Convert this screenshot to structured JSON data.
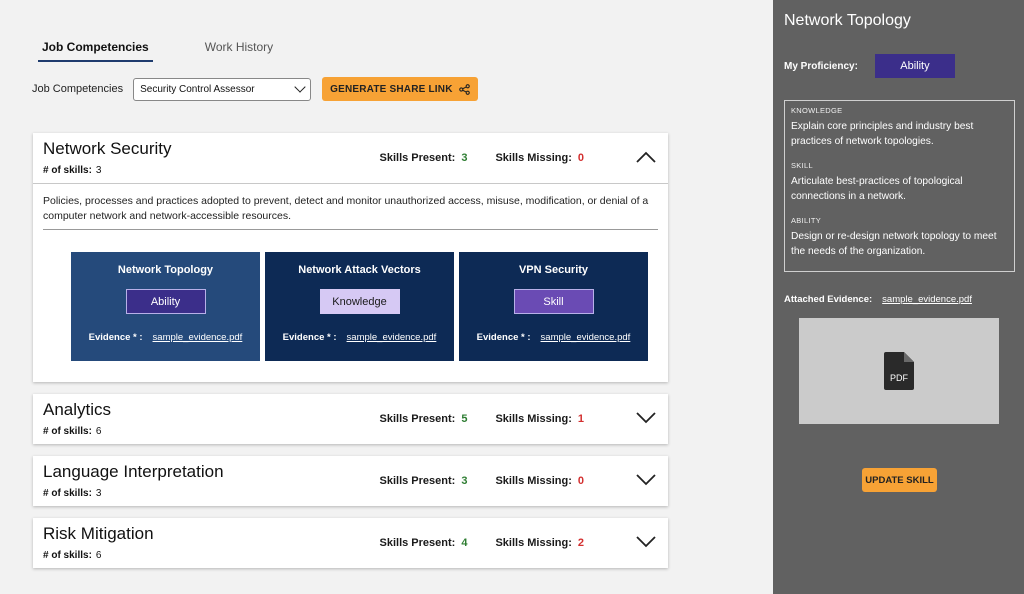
{
  "tabs": [
    {
      "label": "Job Competencies",
      "active": true
    },
    {
      "label": "Work History",
      "active": false
    }
  ],
  "filter": {
    "label": "Job Competencies",
    "selected": "Security Control Assessor",
    "share_button": "GENERATE SHARE LINK"
  },
  "labels": {
    "num_skills": "# of skills:",
    "skills_present": "Skills Present:",
    "skills_missing": "Skills Missing:",
    "evidence": "Evidence * :"
  },
  "competencies": [
    {
      "title": "Network Security",
      "num_skills": "3",
      "present": "3",
      "missing": "0",
      "expanded": true,
      "description": "Policies, processes and practices adopted to prevent, detect and monitor unauthorized access, misuse, modification, or denial of a computer network and network-accessible resources.",
      "skills": [
        {
          "title": "Network Topology",
          "tag": "Ability",
          "evidence": "sample_evidence.pdf",
          "bg": "#254a7b",
          "tag_bg": "#3b2e8a",
          "tag_color": "#ffffff"
        },
        {
          "title": "Network Attack Vectors",
          "tag": "Knowledge",
          "evidence": "sample_evidence.pdf",
          "bg": "#0d2a55",
          "tag_bg": "#d6c9f4",
          "tag_color": "#1a1a1a"
        },
        {
          "title": "VPN Security",
          "tag": "Skill",
          "evidence": "sample_evidence.pdf",
          "bg": "#0d2a55",
          "tag_bg": "#6a4bb4",
          "tag_color": "#ffffff"
        }
      ]
    },
    {
      "title": "Analytics",
      "num_skills": "6",
      "present": "5",
      "missing": "1",
      "expanded": false
    },
    {
      "title": "Language Interpretation",
      "num_skills": "3",
      "present": "3",
      "missing": "0",
      "expanded": false
    },
    {
      "title": "Risk Mitigation",
      "num_skills": "6",
      "present": "4",
      "missing": "2",
      "expanded": false
    }
  ],
  "panel": {
    "title": "Network Topology",
    "proficiency_label": "My Proficiency:",
    "proficiency": "Ability",
    "sections": [
      {
        "label": "KNOWLEDGE",
        "text": "Explain core principles and industry best practices of network topologies."
      },
      {
        "label": "SKILL",
        "text": "Articulate best-practices of topological connections in a network."
      },
      {
        "label": "ABILITY",
        "text": "Design or re-design network topology to meet the needs of the organization."
      }
    ],
    "evidence_label": "Attached Evidence:",
    "evidence_file": "sample_evidence.pdf",
    "preview_icon": "pdf-file-icon",
    "preview_icon_text": "PDF",
    "update_button": "UPDATE SKILL"
  },
  "colors": {
    "accent_orange": "#f7a235",
    "present_green": "#2e7d32",
    "missing_red": "#d32f2f",
    "panel_bg": "#616161",
    "tab_underline": "#1f3c6e"
  }
}
